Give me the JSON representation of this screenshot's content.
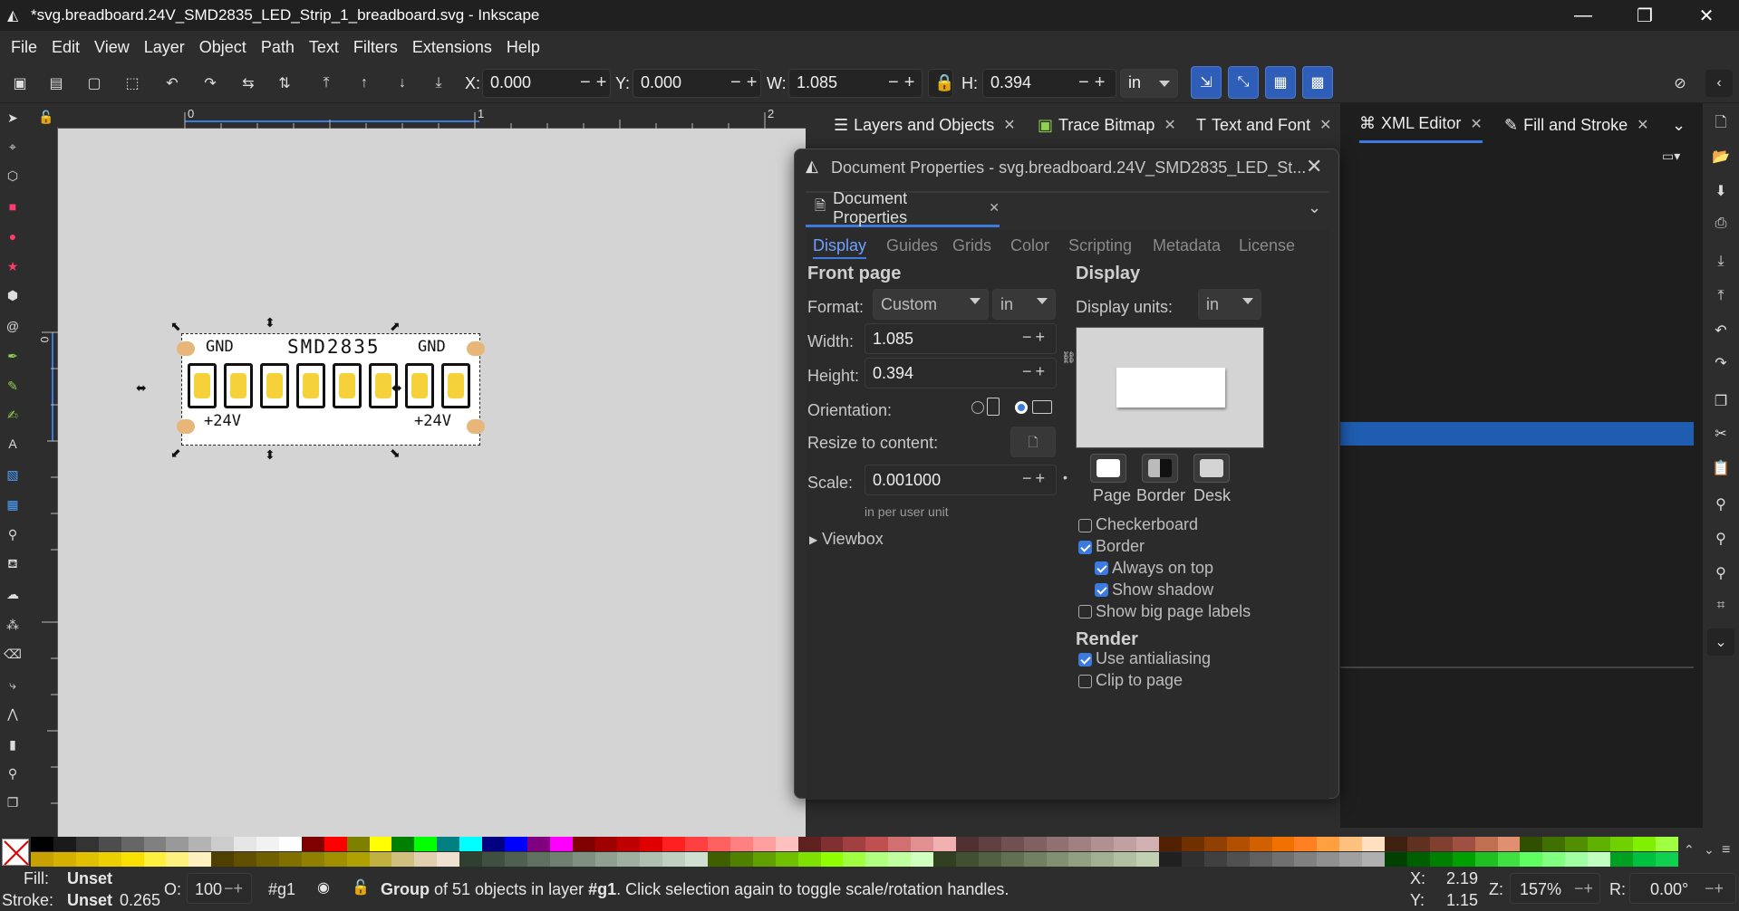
{
  "window": {
    "title": "*svg.breadboard.24V_SMD2835_LED_Strip_1_breadboard.svg - Inkscape",
    "controls": [
      "minimize-icon",
      "restore-icon",
      "close-icon"
    ]
  },
  "menu": [
    "File",
    "Edit",
    "View",
    "Layer",
    "Object",
    "Path",
    "Text",
    "Filters",
    "Extensions",
    "Help"
  ],
  "toolbar": {
    "x_label": "X:",
    "x_value": "0.000",
    "y_label": "Y:",
    "y_value": "0.000",
    "w_label": "W:",
    "w_value": "1.085",
    "h_label": "H:",
    "h_value": "0.394",
    "unit": "in",
    "minus": "−",
    "plus": "+"
  },
  "ruler": {
    "ticks": [
      "0",
      "1",
      "2"
    ],
    "vtick": "0"
  },
  "canvas_strip": {
    "top_left": "GND",
    "top_center": "SMD2835",
    "top_right": "GND",
    "bottom_left": "+24V",
    "bottom_right": "+24V",
    "led_count": 8,
    "led_color": "#f5d23a",
    "pad_color": "#e8b679"
  },
  "dock_tabs": [
    {
      "label": "Layers and Objects",
      "icon": "layers-icon"
    },
    {
      "label": "Trace Bitmap",
      "icon": "trace-bitmap-icon"
    },
    {
      "label": "Text and Font",
      "icon": "text-icon"
    },
    {
      "label": "XML Editor",
      "icon": "xml-editor-icon",
      "active": true
    },
    {
      "label": "Fill and Stroke",
      "icon": "fill-stroke-icon"
    }
  ],
  "dialog": {
    "title": "Document Properties - svg.breadboard.24V_SMD2835_LED_St...",
    "tab_label": "Document Properties",
    "subtabs": [
      "Display",
      "Guides",
      "Grids",
      "Color",
      "Scripting",
      "Metadata",
      "License"
    ],
    "front_page": {
      "heading": "Front page",
      "format_label": "Format:",
      "format_value": "Custom",
      "format_unit": "in",
      "width_label": "Width:",
      "width_value": "1.085",
      "height_label": "Height:",
      "height_value": "0.394",
      "orientation_label": "Orientation:",
      "resize_label": "Resize to content:",
      "scale_label": "Scale:",
      "scale_value": "0.001000",
      "scale_note": "in per user unit",
      "viewbox_label": "Viewbox"
    },
    "display": {
      "heading": "Display",
      "units_label": "Display units:",
      "units_value": "in",
      "swatches": [
        "Page",
        "Border",
        "Desk"
      ],
      "checkboxes": [
        {
          "label": "Checkerboard",
          "checked": false
        },
        {
          "label": "Border",
          "checked": true
        },
        {
          "label": "Always on top",
          "checked": true
        },
        {
          "label": "Show shadow",
          "checked": true
        },
        {
          "label": "Show big page labels",
          "checked": false
        }
      ]
    },
    "render": {
      "heading": "Render",
      "checkboxes": [
        {
          "label": "Use antialiasing",
          "checked": true
        },
        {
          "label": "Clip to page",
          "checked": false
        }
      ]
    }
  },
  "status": {
    "fill_label": "Fill:",
    "fill_value": "Unset",
    "stroke_label": "Stroke:",
    "stroke_value": "Unset",
    "stroke_width": "0.265",
    "opacity_label": "O:",
    "opacity_value": "100",
    "layer": "#g1",
    "message_bold": "Group",
    "message": " of 51 objects in layer ",
    "message_layer": "#g1",
    "message_tail": ". Click selection again to toggle scale/rotation handles.",
    "cursor_x_label": "X:",
    "cursor_x": "2.19",
    "cursor_y_label": "Y:",
    "cursor_y": "1.15",
    "zoom_label": "Z:",
    "zoom_value": "157%",
    "rotation_label": "R:",
    "rotation_value": "0.00°"
  },
  "colors": {
    "accent": "#2f5eb8",
    "selection": "#1f5db0"
  }
}
